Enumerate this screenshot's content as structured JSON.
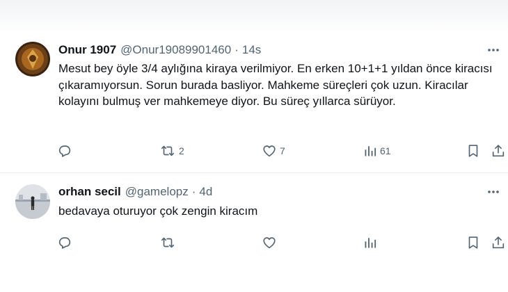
{
  "posts": [
    {
      "author_name": "Onur 1907",
      "handle": "@Onur19089901460",
      "separator": "·",
      "time": "14s",
      "text": "Mesut bey öyle 3/4 aylığına kiraya verilmiyor. En erken 10+1+1 yıldan önce kiracısı çıkaramıyorsun. Sorun burada basliyor. Mahkeme süreçleri çok uzun. Kiracılar kolayını bulmuş ver mahkemeye diyor. Bu süreç yıllarca sürüyor.",
      "reposts": "2",
      "likes": "7",
      "views": "61"
    },
    {
      "author_name": "orhan secil",
      "handle": "@gamelopz",
      "separator": "·",
      "time": "4d",
      "text": "bedavaya oturuyor çok zengin kiracım",
      "reposts": "",
      "likes": "",
      "views": ""
    }
  ],
  "icons": {
    "more": "more-horizontal-icon",
    "reply": "reply-icon",
    "repost": "repost-icon",
    "like": "like-icon",
    "views": "views-icon",
    "bookmark": "bookmark-icon",
    "share": "share-icon"
  },
  "colors": {
    "text": "#0f1419",
    "muted": "#536471",
    "divider": "#e6ecf0"
  }
}
